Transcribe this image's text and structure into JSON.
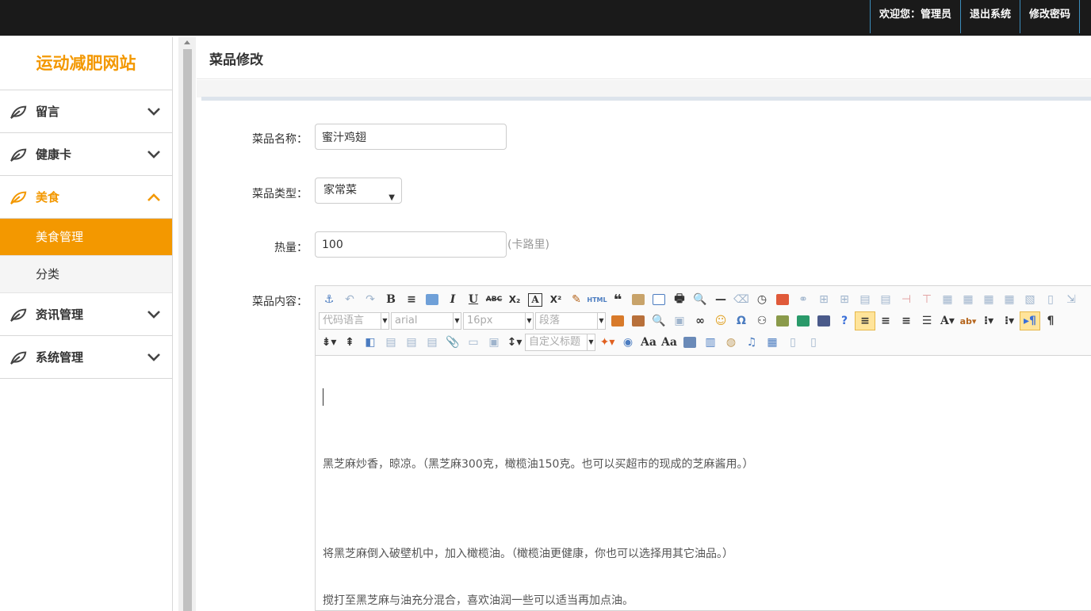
{
  "topnav": {
    "welcome": "欢迎您：管理员",
    "logout": "退出系统",
    "change_password": "修改密码"
  },
  "sidebar": {
    "brand": "运动减肥网站",
    "items": [
      {
        "label": "留言",
        "icon": "leaf-icon",
        "expanded": false
      },
      {
        "label": "健康卡",
        "icon": "leaf-icon",
        "expanded": false
      },
      {
        "label": "美食",
        "icon": "leaf-icon",
        "expanded": true,
        "children": [
          {
            "label": "美食管理",
            "active": true
          },
          {
            "label": "分类",
            "active": false
          }
        ]
      },
      {
        "label": "资讯管理",
        "icon": "leaf-icon",
        "expanded": false
      },
      {
        "label": "系统管理",
        "icon": "leaf-icon",
        "expanded": false
      }
    ]
  },
  "page": {
    "title": "菜品修改"
  },
  "form": {
    "name_label": "菜品名称：",
    "name_value": "蜜汁鸡翅",
    "type_label": "菜品类型：",
    "type_value": "家常菜",
    "calories_label": "热量：",
    "calories_value": "100",
    "calories_unit": "(卡路里)",
    "content_label": "菜品内容："
  },
  "editor": {
    "combos": {
      "code_language": "代码语言",
      "font_family": "arial",
      "font_size": "16px",
      "paragraph": "段落",
      "custom_heading": "自定义标题"
    },
    "paragraphs": [
      "黑芝麻炒香，晾凉。（黑芝麻300克，橄榄油150克。也可以买超市的现成的芝麻酱用。）",
      "将黑芝麻倒入破壁机中，加入橄榄油。（橄榄油更健康，你也可以选择用其它油品。）",
      "搅打至黑芝麻与油充分混合，喜欢油润一些可以适当再加点油。"
    ]
  },
  "colors": {
    "accent": "#f39800",
    "topbar": "#1a1a1a",
    "topnav_divider": "#3c8dbc"
  }
}
